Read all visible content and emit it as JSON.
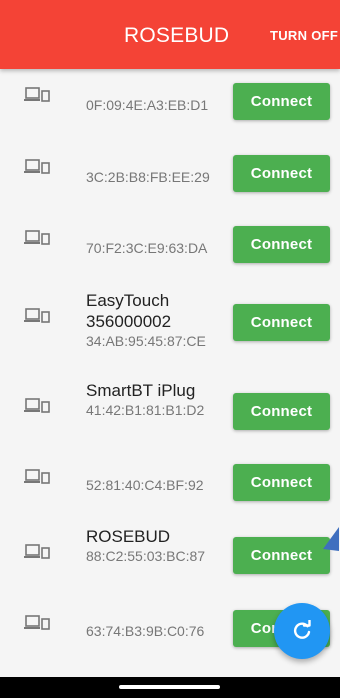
{
  "appbar": {
    "title": "ROSEBUD",
    "action_label": "TURN OFF",
    "color": "#f44336"
  },
  "devices": [
    {
      "name": "",
      "address": "0F:09:4E:A3:EB:D1",
      "button_label": "Connect",
      "icon": "device-icon"
    },
    {
      "name": "",
      "address": "3C:2B:B8:FB:EE:29",
      "button_label": "Connect",
      "icon": "device-icon"
    },
    {
      "name": "",
      "address": "70:F2:3C:E9:63:DA",
      "button_label": "Connect",
      "icon": "device-icon"
    },
    {
      "name": "EasyTouch 356000002",
      "address": "34:AB:95:45:87:CE",
      "button_label": "Connect",
      "icon": "device-icon"
    },
    {
      "name": "SmartBT iPlug",
      "address": "41:42:B1:81:B1:D2",
      "button_label": "Connect",
      "icon": "device-icon"
    },
    {
      "name": "",
      "address": "52:81:40:C4:BF:92",
      "button_label": "Connect",
      "icon": "device-icon"
    },
    {
      "name": "ROSEBUD",
      "address": "88:C2:55:03:BC:87",
      "button_label": "Connect",
      "icon": "device-icon"
    },
    {
      "name": "",
      "address": "63:74:B3:9B:C0:76",
      "button_label": "Connect",
      "icon": "device-icon"
    }
  ],
  "fab": {
    "icon": "refresh-icon",
    "color": "#2196f3"
  },
  "colors": {
    "button": "#4caf50",
    "background": "#f5f5f5",
    "cursor": "#3f6fbf"
  }
}
